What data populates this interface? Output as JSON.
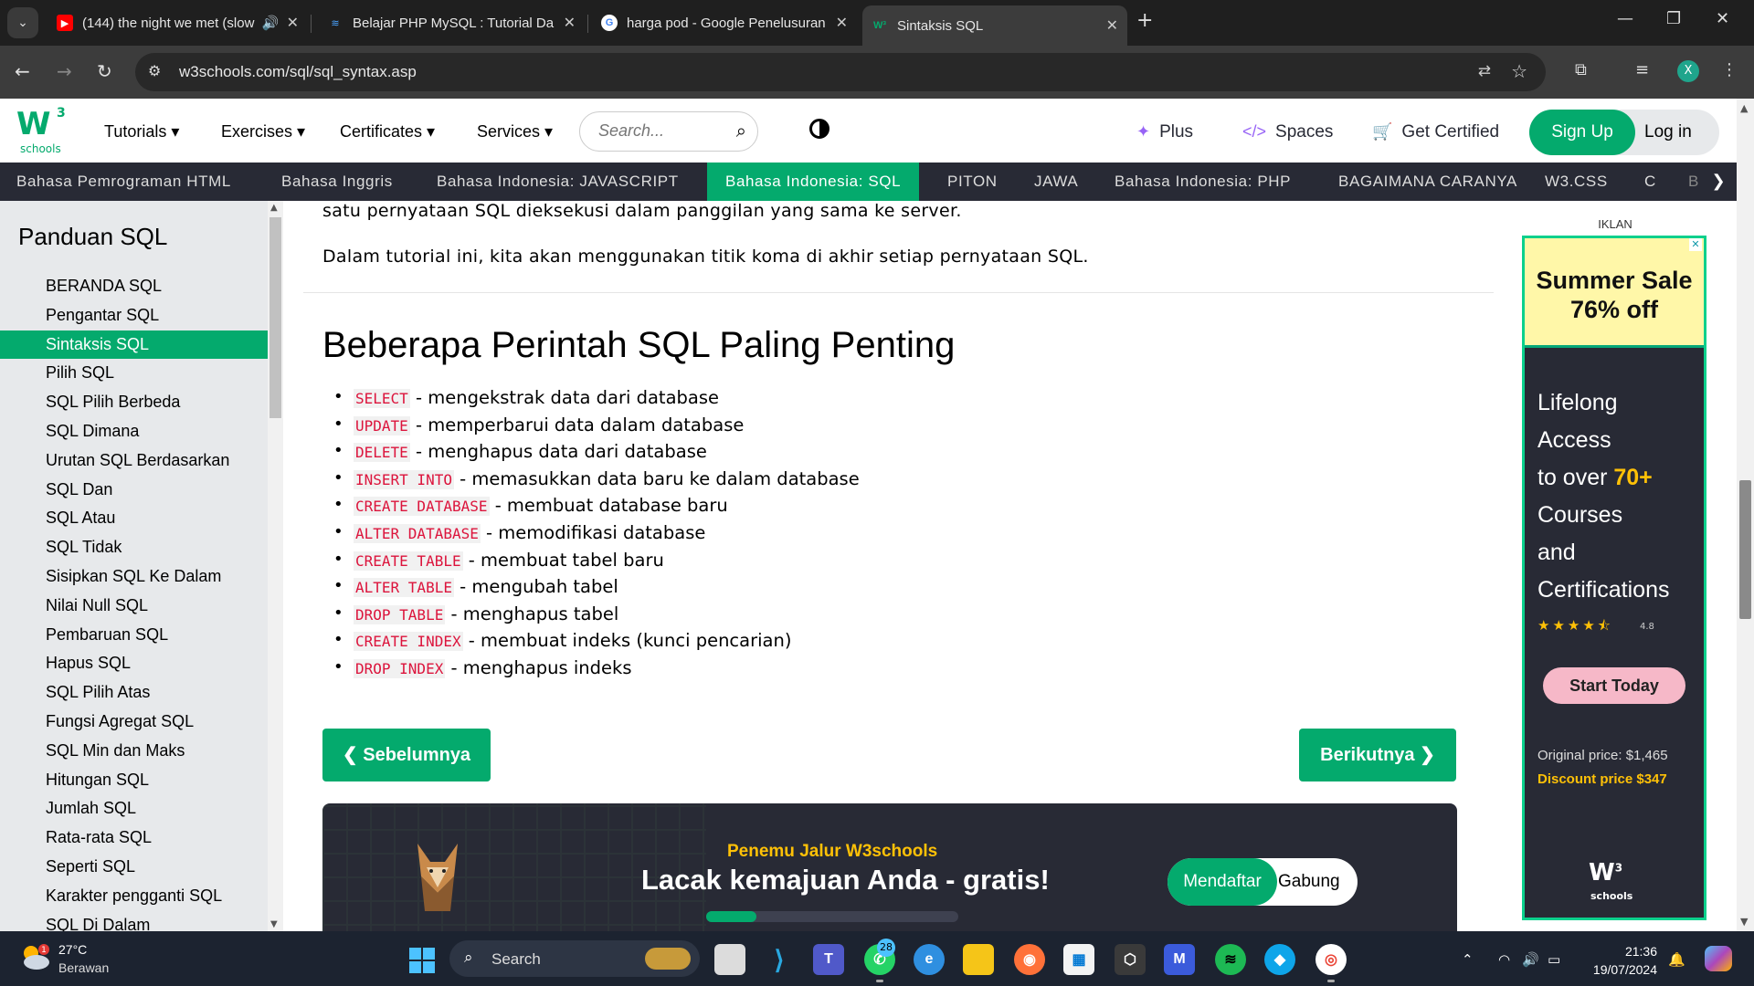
{
  "browser": {
    "tabs": [
      {
        "title": "(144) the night we met (slow",
        "icon": "youtube-icon",
        "audio": true
      },
      {
        "title": "Belajar PHP MySQL : Tutorial Da",
        "icon": "site-icon"
      },
      {
        "title": "harga pod - Google Penelusuran",
        "icon": "google-icon"
      },
      {
        "title": "Sintaksis SQL",
        "icon": "w3schools-icon",
        "active": true
      }
    ],
    "url": "w3schools.com/sql/sql_syntax.asp",
    "profile_initial": "X"
  },
  "site": {
    "logo_sub": "schools",
    "menu": [
      "Tutorials",
      "Exercises",
      "Certificates",
      "Services"
    ],
    "search_placeholder": "Search...",
    "right_links": {
      "plus": "Plus",
      "spaces": "Spaces",
      "certified": "Get Certified"
    },
    "signup": "Sign Up",
    "login": "Log in",
    "subnav": [
      "Bahasa Pemrograman HTML",
      "Bahasa Inggris",
      "Bahasa Indonesia: JAVASCRIPT",
      "Bahasa Indonesia: SQL",
      "PITON",
      "JAWA",
      "Bahasa Indonesia: PHP",
      "BAGAIMANA CARANYA",
      "W3.CSS",
      "C",
      "B"
    ],
    "subnav_active_index": 3
  },
  "sidebar": {
    "title": "Panduan SQL",
    "items": [
      "BERANDA SQL",
      "Pengantar SQL",
      "Sintaksis SQL",
      "Pilih SQL",
      "SQL Pilih Berbeda",
      "SQL Dimana",
      "Urutan SQL Berdasarkan",
      "SQL Dan",
      "SQL Atau",
      "SQL Tidak",
      "Sisipkan SQL Ke Dalam",
      "Nilai Null SQL",
      "Pembaruan SQL",
      "Hapus SQL",
      "SQL Pilih Atas",
      "Fungsi Agregat SQL",
      "SQL Min dan Maks",
      "Hitungan SQL",
      "Jumlah SQL",
      "Rata-rata SQL",
      "Seperti SQL",
      "Karakter pengganti SQL",
      "SQL Di Dalam"
    ],
    "active_index": 2
  },
  "main": {
    "p1": "satu pernyataan SQL dieksekusi dalam panggilan yang sama ke server.",
    "p2": "Dalam tutorial ini, kita akan menggunakan titik koma di akhir setiap pernyataan SQL.",
    "heading": "Beberapa Perintah SQL Paling Penting",
    "commands": [
      {
        "code": "SELECT",
        "desc": " - mengekstrak data dari database"
      },
      {
        "code": "UPDATE",
        "desc": " - memperbarui data dalam database"
      },
      {
        "code": "DELETE",
        "desc": " - menghapus data dari database"
      },
      {
        "code": "INSERT INTO",
        "desc": " - memasukkan data baru ke dalam database"
      },
      {
        "code": "CREATE DATABASE",
        "desc": " - membuat database baru"
      },
      {
        "code": "ALTER DATABASE",
        "desc": " - memodifikasi database"
      },
      {
        "code": "CREATE TABLE",
        "desc": " - membuat tabel baru"
      },
      {
        "code": "ALTER TABLE",
        "desc": " - mengubah tabel"
      },
      {
        "code": "DROP TABLE",
        "desc": " - menghapus tabel"
      },
      {
        "code": "CREATE INDEX",
        "desc": " - membuat indeks (kunci pencarian)"
      },
      {
        "code": "DROP INDEX",
        "desc": " - menghapus indeks"
      }
    ],
    "prev": "❮ Sebelumnya",
    "next": "Berikutnya ❯",
    "banner": {
      "kicker": "Penemu Jalur W3schools",
      "title": "Lacak kemajuan Anda - gratis!",
      "signup": "Mendaftar",
      "join": "Gabung",
      "progress": 0.2
    }
  },
  "ad": {
    "label": "IKLAN",
    "sale_line1": "Summer Sale",
    "sale_line2": "76% off",
    "l1": "Lifelong",
    "l2": "Access",
    "l3a": "to over ",
    "l3b": "70+",
    "l4": "Courses",
    "l5": "and",
    "l6": "Certifications",
    "rating": "4.8",
    "cta": "Start Today",
    "original": "Original price: $1,465",
    "discount": "Discount price $347",
    "logo_sub": "schools"
  },
  "taskbar": {
    "temp": "27°C",
    "weather": "Berawan",
    "search": "Search",
    "whatsapp_badge": "28",
    "time": "21:36",
    "date": "19/07/2024"
  }
}
